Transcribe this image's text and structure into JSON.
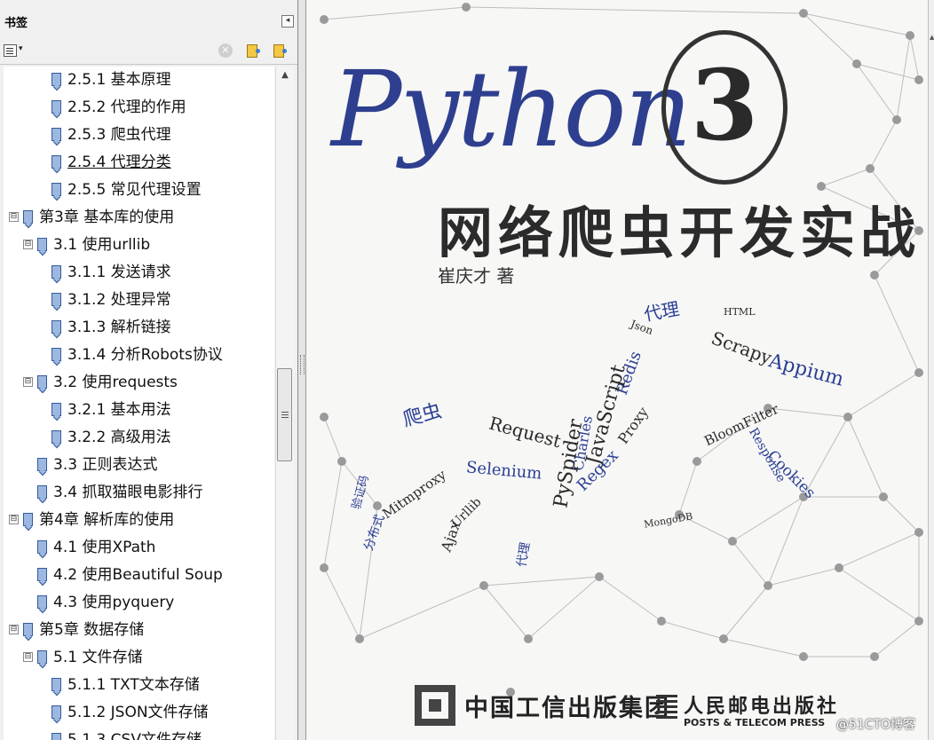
{
  "panel": {
    "title": "书签",
    "collapse_glyph": "◂",
    "options_arrow": "▾",
    "delete_glyph": "✕"
  },
  "bookmarks": [
    {
      "label": "2.5.1 基本原理",
      "level": 2,
      "expander": ""
    },
    {
      "label": "2.5.2 代理的作用",
      "level": 2,
      "expander": ""
    },
    {
      "label": "2.5.3 爬虫代理",
      "level": 2,
      "expander": ""
    },
    {
      "label": "2.5.4 代理分类",
      "level": 2,
      "expander": "",
      "hover": true
    },
    {
      "label": "2.5.5 常见代理设置",
      "level": 2,
      "expander": ""
    },
    {
      "label": "第3章 基本库的使用",
      "level": 0,
      "expander": "⊟"
    },
    {
      "label": "3.1 使用urllib",
      "level": 1,
      "expander": "⊟"
    },
    {
      "label": "3.1.1 发送请求",
      "level": 2,
      "expander": ""
    },
    {
      "label": "3.1.2 处理异常",
      "level": 2,
      "expander": ""
    },
    {
      "label": "3.1.3 解析链接",
      "level": 2,
      "expander": ""
    },
    {
      "label": "3.1.4 分析Robots协议",
      "level": 2,
      "expander": ""
    },
    {
      "label": "3.2 使用requests",
      "level": 1,
      "expander": "⊟"
    },
    {
      "label": "3.2.1 基本用法",
      "level": 2,
      "expander": ""
    },
    {
      "label": "3.2.2 高级用法",
      "level": 2,
      "expander": ""
    },
    {
      "label": "3.3 正则表达式",
      "level": 1,
      "expander": ""
    },
    {
      "label": "3.4 抓取猫眼电影排行",
      "level": 1,
      "expander": ""
    },
    {
      "label": "第4章 解析库的使用",
      "level": 0,
      "expander": "⊟"
    },
    {
      "label": "4.1 使用XPath",
      "level": 1,
      "expander": ""
    },
    {
      "label": "4.2 使用Beautiful Soup",
      "level": 1,
      "expander": ""
    },
    {
      "label": "4.3 使用pyquery",
      "level": 1,
      "expander": ""
    },
    {
      "label": "第5章 数据存储",
      "level": 0,
      "expander": "⊟"
    },
    {
      "label": "5.1 文件存储",
      "level": 1,
      "expander": "⊟"
    },
    {
      "label": "5.1.1 TXT文本存储",
      "level": 2,
      "expander": ""
    },
    {
      "label": "5.1.2 JSON文件存储",
      "level": 2,
      "expander": ""
    },
    {
      "label": "5.1.3 CSV文件存储",
      "level": 2,
      "expander": ""
    }
  ],
  "cover": {
    "title_word": "Python",
    "title_num": "3",
    "subtitle": "网络爬虫开发实战",
    "author": "崔庆才 著",
    "publisher1": "中国工信出版集团",
    "publisher2": "人民邮电出版社",
    "publisher2_en": "POSTS & TELECOM PRESS",
    "word_cloud": [
      "代理",
      "HTML",
      "Json",
      "Redis",
      "Appium",
      "爬虫",
      "Request",
      "JavaScript",
      "Proxy",
      "BloomFilter",
      "Cookies",
      "Response",
      "Selenium",
      "Charles",
      "PySpider",
      "Regex",
      "Mitmproxy",
      "Urllib",
      "Ajax",
      "Scrapy",
      "分布式",
      "验证码",
      "MongoDB",
      "代理"
    ],
    "watermark": "@51CTO博客"
  },
  "colors": {
    "title_blue": "#2f3f8f",
    "wordcloud_blue": "#2b3f94",
    "wordcloud_dark": "#2a2a2a"
  }
}
